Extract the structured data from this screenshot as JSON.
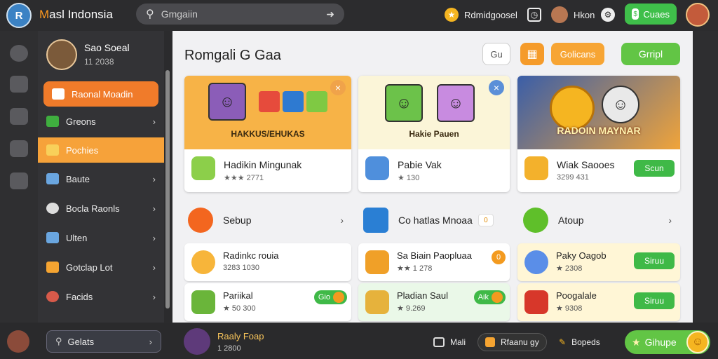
{
  "app": {
    "brand_prefix": "M",
    "brand_rest": "asl Indonsia",
    "avatar_letter": "R"
  },
  "search": {
    "placeholder": "Gmgaiin"
  },
  "top": {
    "promo_label": "Rdmidgoosel",
    "user_name": "Hkon",
    "cta_label": "Cuaes"
  },
  "sidebar": {
    "profile_name": "Sao Soeal",
    "profile_sub": "11 2038",
    "items": [
      {
        "label": "Raonal Moadin",
        "icon_color": "#ffffff"
      },
      {
        "label": "Greons",
        "icon_color": "#3fae3f"
      },
      {
        "label": "Pochies",
        "icon_color": "#f8c24a"
      },
      {
        "label": "Baute",
        "icon_color": "#6aa6e0"
      },
      {
        "label": "Bocla Raonls",
        "icon_color": "#dddddd"
      },
      {
        "label": "Ulten",
        "icon_color": "#6aa6e0"
      },
      {
        "label": "Gotclap Lot",
        "icon_color": "#f5a431"
      },
      {
        "label": "Facids",
        "icon_color": "#d75a4a"
      }
    ]
  },
  "main": {
    "title": "Romgali G Gaa",
    "header_buttons": {
      "icon_button_label": "Gu",
      "grid_icon": "grid-icon",
      "orange_label": "Golicans",
      "green_label": "Grripl"
    },
    "cards": [
      {
        "banner_title": "HAKKUS/EHUKAS",
        "title": "Hadikin Mingunak",
        "sub": "★★★ 2771",
        "close": "×",
        "banner_color": "#f7b347"
      },
      {
        "banner_title": "Hakie Pauen",
        "title": "Pabie Vak",
        "sub": "★ 130",
        "close": "×",
        "banner_color": "#fbf5d8"
      },
      {
        "banner_title": "RADOIN MAYNAR",
        "title": "Wiak Saooes",
        "sub": "3299 431",
        "button": "Scun",
        "banner_color": "#e69a2c"
      }
    ],
    "sections": [
      {
        "label": "Sebup",
        "icon_color": "#f3661f"
      },
      {
        "label": "Co hatlas Mnoaa",
        "icon_color": "#2a7fd4",
        "badge": "0"
      },
      {
        "label": "Atoup",
        "icon_color": "#5fbf2a"
      }
    ],
    "list": [
      {
        "title": "Radinkc rouia",
        "sub": "3283 1030",
        "icon_color": "#f7b53a"
      },
      {
        "title": "Sa Biain Paopluaa",
        "sub": "★★ 1 278",
        "icon_color": "#f0a028",
        "badge": "0"
      },
      {
        "title": "Paky Oagob",
        "sub": "★ 2308",
        "icon_color": "#5a8ee8",
        "button": "Siruu"
      },
      {
        "title": "Pariikal",
        "sub": "★ 50 300",
        "icon_color": "#6ab53a",
        "pill": "Gio"
      },
      {
        "title": "Pladian Saul",
        "sub": "★ 9.269",
        "icon_color": "#e6b23c",
        "pill": "Aik"
      },
      {
        "title": "Poogalale",
        "sub": "★ 9308",
        "icon_color": "#d7372a",
        "button": "Siruu"
      }
    ]
  },
  "bottom": {
    "search_label": "Gelats",
    "user_name": "Raaly Foap",
    "user_sub": "1 2800",
    "item1": "Mali",
    "item2": "Rfaanu gy",
    "item3": "Bopeds",
    "cta": "Gihupe",
    "coin": "☺"
  }
}
